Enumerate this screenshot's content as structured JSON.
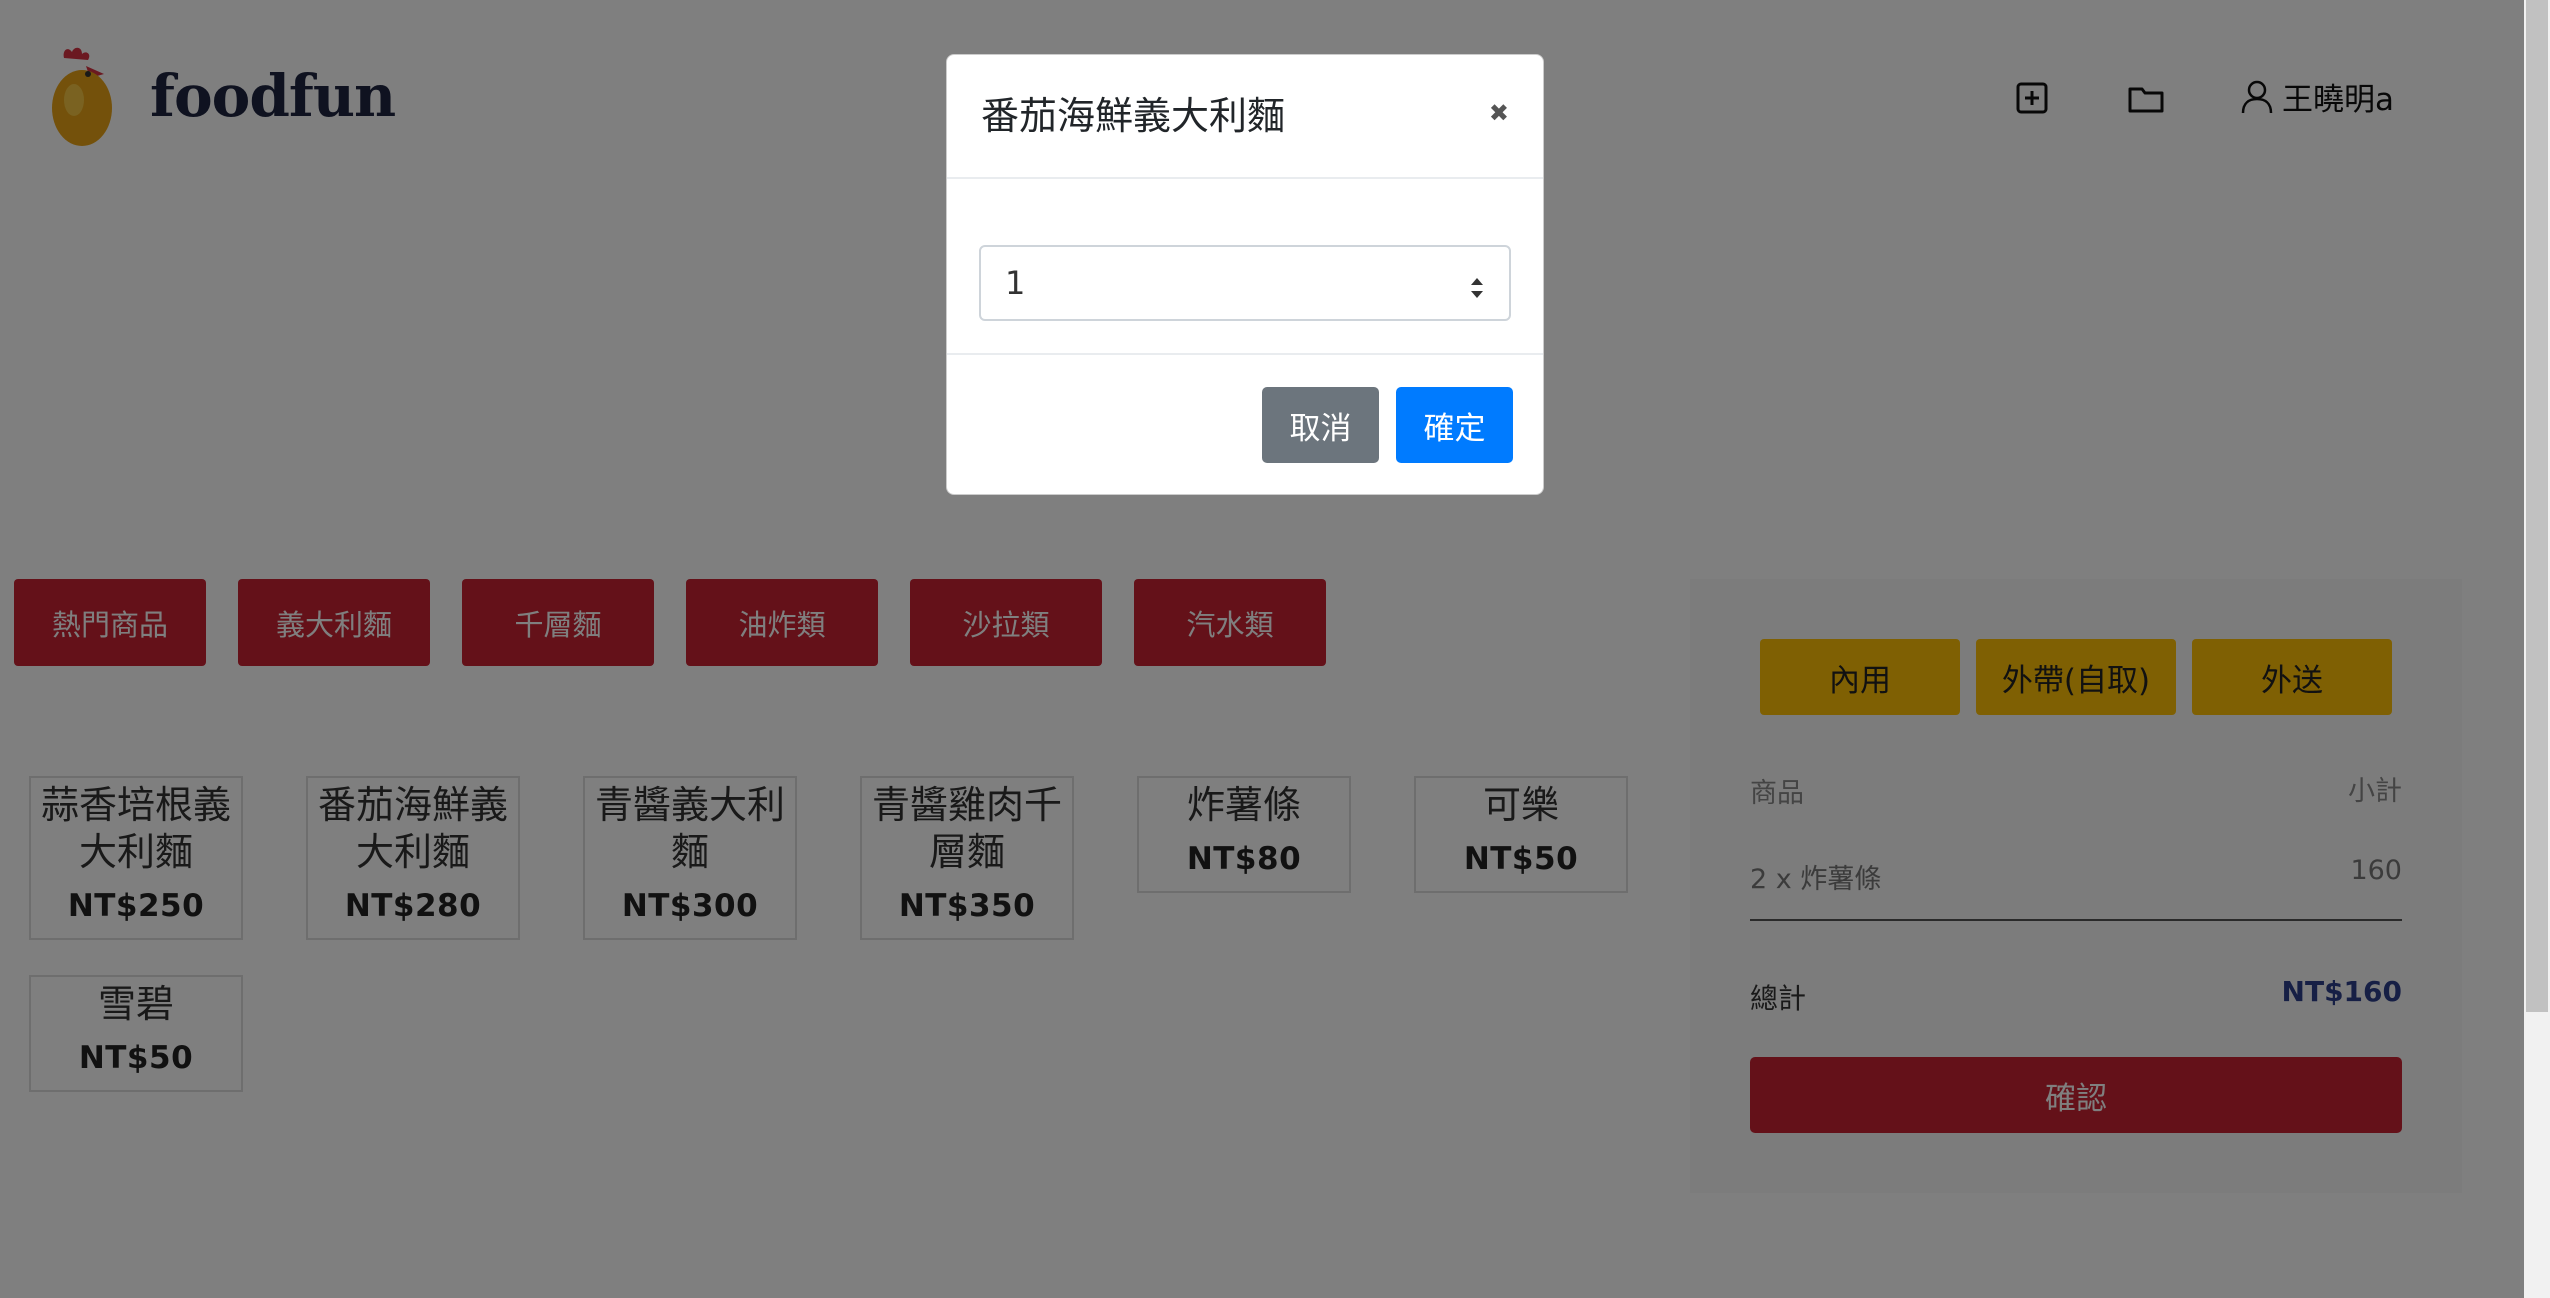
{
  "header": {
    "brand": "foodfun",
    "user_name": "王曉明a",
    "icons": [
      "plus-square-icon",
      "folder-icon",
      "user-icon"
    ]
  },
  "categories": [
    "熱門商品",
    "義大利麵",
    "千層麵",
    "油炸類",
    "沙拉類",
    "汽水類"
  ],
  "products": [
    {
      "name": "蒜香培根義大利麵",
      "price": "NT$250"
    },
    {
      "name": "番茄海鮮義大利麵",
      "price": "NT$280"
    },
    {
      "name": "青醬義大利麵",
      "price": "NT$300"
    },
    {
      "name": "青醬雞肉千層麵",
      "price": "NT$350"
    },
    {
      "name": "炸薯條",
      "price": "NT$80"
    },
    {
      "name": "可樂",
      "price": "NT$50"
    },
    {
      "name": "雪碧",
      "price": "NT$50"
    }
  ],
  "order": {
    "service_options": [
      "內用",
      "外帶(自取)",
      "外送"
    ],
    "col_item": "商品",
    "col_subtotal": "小計",
    "items": [
      {
        "label": "2 x 炸薯條",
        "subtotal": "160"
      }
    ],
    "total_label": "總計",
    "total_value": "NT$160",
    "confirm_label": "確認"
  },
  "modal": {
    "title": "番茄海鮮義大利麵",
    "close_glyph": "✖",
    "quantity": "1",
    "cancel_label": "取消",
    "ok_label": "確定"
  },
  "colors": {
    "category": "#c82333",
    "service": "#ffc107",
    "ok_button": "#007bff",
    "cancel_button": "#6c757d"
  }
}
